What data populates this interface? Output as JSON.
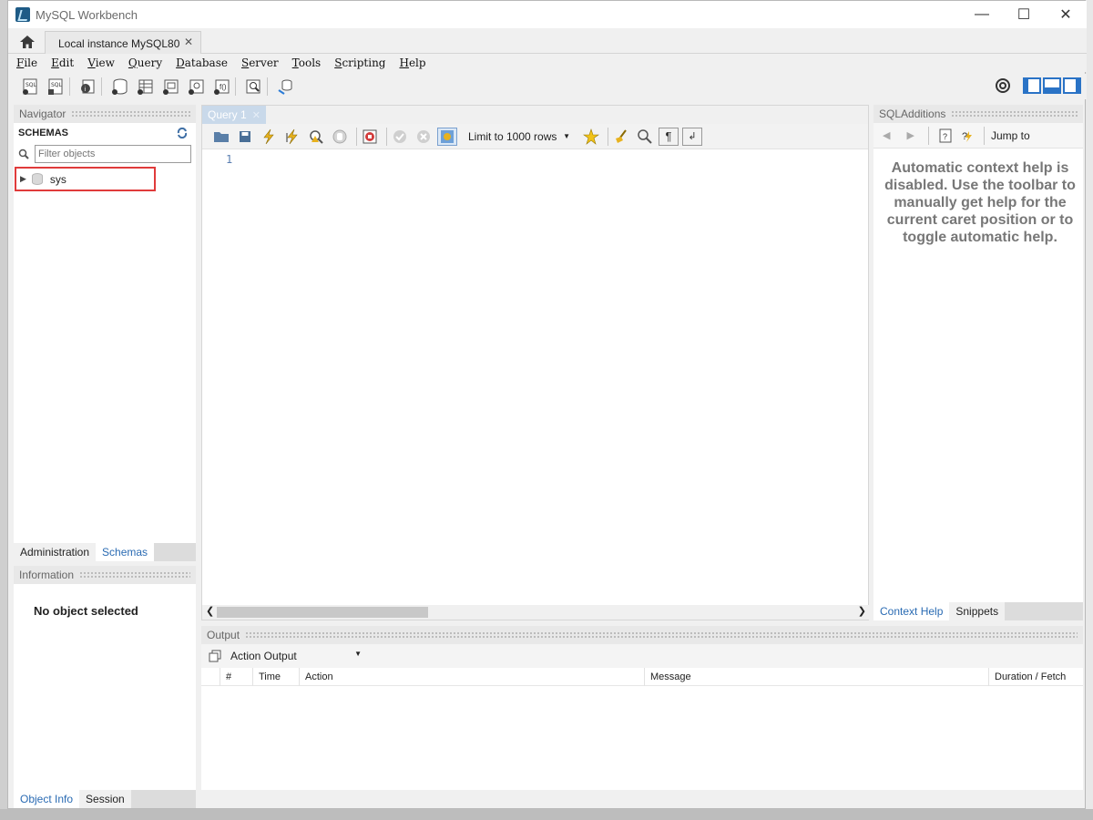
{
  "window": {
    "title": "MySQL Workbench"
  },
  "tabs": {
    "connection_tab": "Local instance MySQL80"
  },
  "menu": [
    "File",
    "Edit",
    "View",
    "Query",
    "Database",
    "Server",
    "Tools",
    "Scripting",
    "Help"
  ],
  "navigator": {
    "title": "Navigator",
    "section": "SCHEMAS",
    "filter_placeholder": "Filter objects",
    "schemas": [
      "sys"
    ],
    "tabs": [
      "Administration",
      "Schemas"
    ]
  },
  "information": {
    "title": "Information",
    "message": "No object selected",
    "tabs": [
      "Object Info",
      "Session"
    ]
  },
  "editor": {
    "tab_label": "Query 1",
    "limit_label": "Limit to 1000 rows",
    "line_number": "1"
  },
  "sql_additions": {
    "title": "SQLAdditions",
    "jump_label": "Jump to",
    "help_text": "Automatic context help is disabled. Use the toolbar to manually get help for the current caret position or to toggle automatic help.",
    "tabs": [
      "Context Help",
      "Snippets"
    ]
  },
  "output": {
    "title": "Output",
    "selector": "Action Output",
    "columns": [
      "#",
      "Time",
      "Action",
      "Message",
      "Duration / Fetch"
    ]
  }
}
